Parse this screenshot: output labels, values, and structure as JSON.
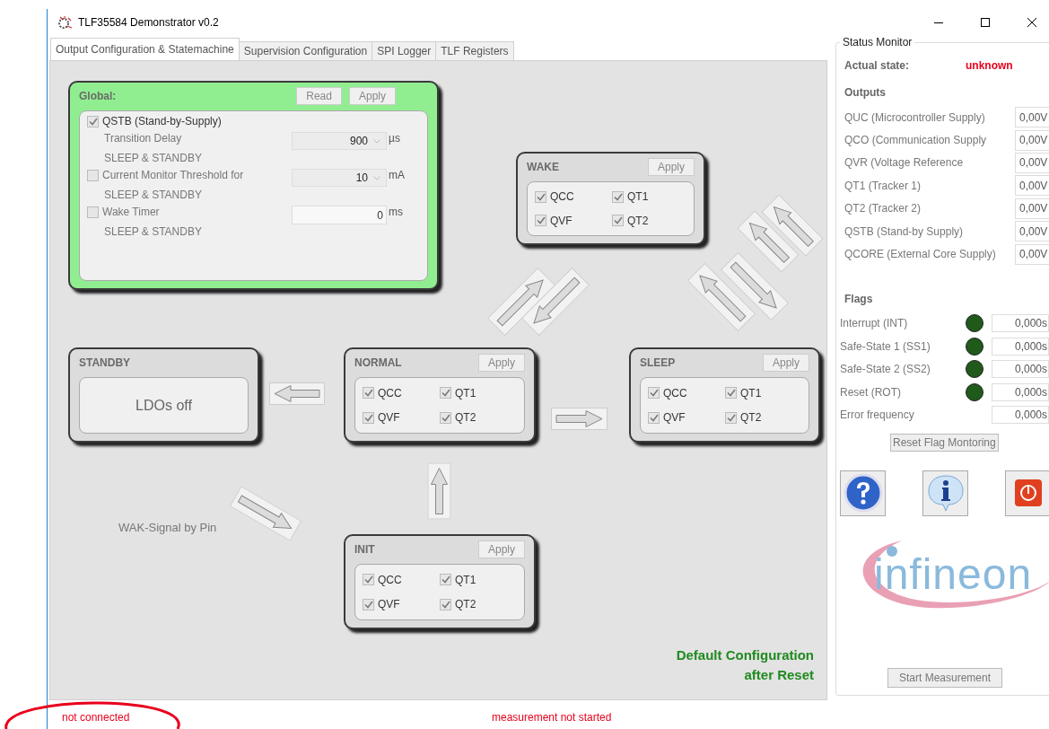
{
  "window": {
    "title": "TLF35584 Demonstrator v0.2"
  },
  "tabs": [
    {
      "label": "Output Configuration & Statemachine",
      "selected": true
    },
    {
      "label": "Supervision Configuration",
      "selected": false
    },
    {
      "label": "SPI Logger",
      "selected": false
    },
    {
      "label": "TLF Registers",
      "selected": false
    }
  ],
  "global": {
    "title": "Global:",
    "buttons": [
      "Read",
      "Apply"
    ],
    "supply": {
      "label": "QSTB (Stand-by-Supply)",
      "checked": true
    },
    "settings": [
      {
        "kind": "dropdown",
        "label": "Transition Delay",
        "sublabel": "SLEEP & STANDBY",
        "value": "900",
        "unit": "µs"
      },
      {
        "kind": "dropdown",
        "label": "Current Monitor Threshold for",
        "sublabel": "SLEEP & STANDBY",
        "value": "10",
        "unit": "mA",
        "checked": false
      },
      {
        "kind": "input",
        "label": "Wake Timer",
        "sublabel": "SLEEP & STANDBY",
        "value": "0",
        "unit": "ms",
        "checked": false
      }
    ]
  },
  "states": [
    {
      "kind": "outputs",
      "title": "WAKE",
      "button": "Apply",
      "outputs": [
        {
          "label": "QCC",
          "checked": true
        },
        {
          "label": "QT1",
          "checked": true
        },
        {
          "label": "QVF",
          "checked": true
        },
        {
          "label": "QT2",
          "checked": true
        }
      ]
    },
    {
      "kind": "message",
      "title": "STANDBY",
      "message": "LDOs off"
    },
    {
      "kind": "outputs",
      "title": "NORMAL",
      "button": "Apply",
      "outputs": [
        {
          "label": "QCC",
          "checked": true
        },
        {
          "label": "QT1",
          "checked": true
        },
        {
          "label": "QVF",
          "checked": true
        },
        {
          "label": "QT2",
          "checked": true
        }
      ]
    },
    {
      "kind": "outputs",
      "title": "SLEEP",
      "button": "Apply",
      "outputs": [
        {
          "label": "QCC",
          "checked": true
        },
        {
          "label": "QT1",
          "checked": true
        },
        {
          "label": "QVF",
          "checked": true
        },
        {
          "label": "QT2",
          "checked": true
        }
      ]
    },
    {
      "kind": "outputs",
      "title": "INIT",
      "button": "Apply",
      "outputs": [
        {
          "label": "QCC",
          "checked": true
        },
        {
          "label": "QT1",
          "checked": true
        },
        {
          "label": "QVF",
          "checked": true
        },
        {
          "label": "QT2",
          "checked": true
        }
      ]
    }
  ],
  "wake_signal_label": "WAK-Signal by Pin",
  "default_note": "Default Configuration\nafter Reset",
  "status_monitor": {
    "title": "Status Monitor",
    "state_label": "Actual state:",
    "state_value": "unknown",
    "outputs_title": "Outputs",
    "outputs": [
      {
        "label": "QUC (Microcontroller Supply)",
        "value": "0,00V"
      },
      {
        "label": "QCO (Communication Supply",
        "value": "0,00V"
      },
      {
        "label": "QVR (Voltage Reference",
        "value": "0,00V"
      },
      {
        "label": "QT1 (Tracker 1)",
        "value": "0,00V"
      },
      {
        "label": "QT2 (Tracker 2)",
        "value": "0,00V"
      },
      {
        "label": "QSTB (Stand-by Supply)",
        "value": "0,00V"
      },
      {
        "label": "QCORE (External Core Supply)",
        "value": "0,00V"
      }
    ],
    "flags_title": "Flags",
    "flags": [
      {
        "label": "Interrupt (INT)",
        "color": "#1f5a1a",
        "value": "0,000s"
      },
      {
        "label": "Safe-State 1 (SS1)",
        "color": "#1f5a1a",
        "value": "0,000s"
      },
      {
        "label": "Safe-State 2 (SS2)",
        "color": "#1f5a1a",
        "value": "0,000s"
      },
      {
        "label": "Reset (ROT)",
        "color": "#1f5a1a",
        "value": "0,000s"
      },
      {
        "label": "Error frequency",
        "value": "0,000s"
      }
    ],
    "reset_button": "Reset Flag Montoring",
    "logo": "infineon",
    "start_button": "Start Measurement"
  },
  "status_bar": {
    "connection": "not connected",
    "measurement": "measurement not started"
  }
}
